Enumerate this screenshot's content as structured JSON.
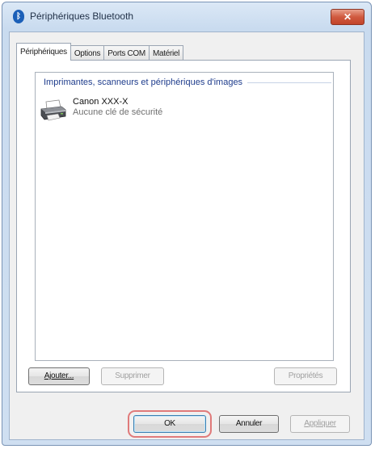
{
  "window": {
    "title": "Périphériques Bluetooth",
    "close_symbol": "✕"
  },
  "tabs": [
    {
      "label": "Périphériques",
      "active": true
    },
    {
      "label": "Options",
      "active": false
    },
    {
      "label": "Ports COM",
      "active": false
    },
    {
      "label": "Matériel",
      "active": false
    }
  ],
  "device_list": {
    "group_label": "Imprimantes, scanneurs et périphériques d'images",
    "devices": [
      {
        "name": "Canon XXX-X",
        "status": "Aucune clé de sécurité",
        "icon": "printer-icon"
      }
    ]
  },
  "panel_buttons": {
    "add": "Ajouter...",
    "remove": "Supprimer",
    "properties": "Propriétés"
  },
  "dialog_buttons": {
    "ok": "OK",
    "cancel": "Annuler",
    "apply": "Appliquer"
  },
  "colors": {
    "highlight": "#e07a7a",
    "close_button": "#c9472e",
    "group_label": "#1e3c8c"
  }
}
